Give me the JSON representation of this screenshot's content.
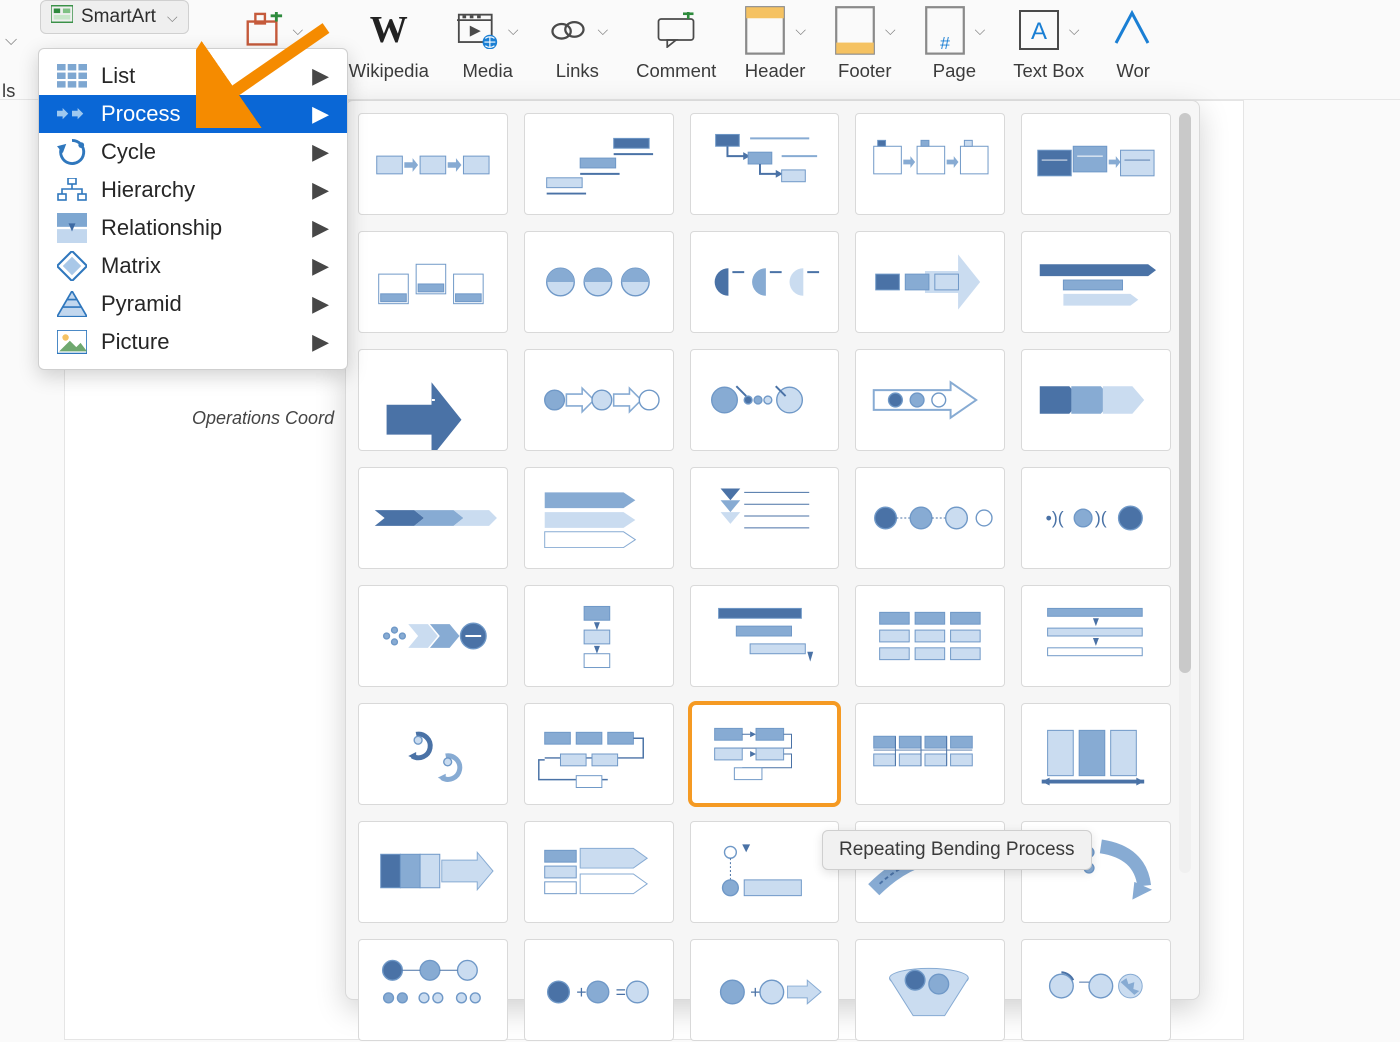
{
  "ribbon": {
    "smartart_label": "SmartArt",
    "items": [
      {
        "name": "get-addins",
        "label": "Get Add-ins",
        "glyph": "addins"
      },
      {
        "name": "wikipedia",
        "label": "Wikipedia",
        "glyph": "W"
      },
      {
        "name": "media",
        "label": "Media",
        "glyph": "media"
      },
      {
        "name": "links",
        "label": "Links",
        "glyph": "links"
      },
      {
        "name": "comment",
        "label": "Comment",
        "glyph": "comment"
      },
      {
        "name": "header",
        "label": "Header",
        "glyph": "header"
      },
      {
        "name": "footer",
        "label": "Footer",
        "glyph": "footer"
      },
      {
        "name": "page",
        "label": "Page",
        "glyph": "page"
      },
      {
        "name": "textbox",
        "label": "Text Box",
        "glyph": "textbox"
      },
      {
        "name": "wordart",
        "label": "Wor",
        "glyph": "wordart"
      }
    ],
    "left_trunc_label": "ls"
  },
  "categories": [
    {
      "name": "list",
      "label": "List",
      "selected": false
    },
    {
      "name": "process",
      "label": "Process",
      "selected": true
    },
    {
      "name": "cycle",
      "label": "Cycle",
      "selected": false
    },
    {
      "name": "hierarchy",
      "label": "Hierarchy",
      "selected": false
    },
    {
      "name": "relationship",
      "label": "Relationship",
      "selected": false
    },
    {
      "name": "matrix",
      "label": "Matrix",
      "selected": false
    },
    {
      "name": "pyramid",
      "label": "Pyramid",
      "selected": false
    },
    {
      "name": "picture",
      "label": "Picture",
      "selected": false
    }
  ],
  "gallery": {
    "highlight_index": 27,
    "tooltip_label": "Repeating Bending Process",
    "thumb_count": 40
  },
  "document": {
    "visible_text": "Operations Coord"
  }
}
